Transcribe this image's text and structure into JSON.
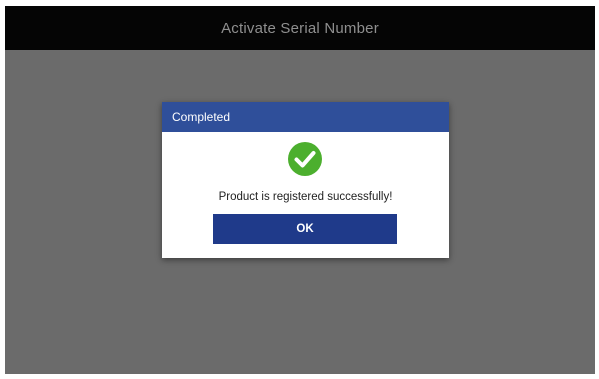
{
  "window": {
    "title": "Activate Serial Number"
  },
  "dialog": {
    "title": "Completed",
    "icon": "checkmark-circle-icon",
    "message": "Product is registered successfully!",
    "ok_label": "OK"
  },
  "colors": {
    "titlebar_bg": "#050505",
    "overlay_bg": "#6b6b6b",
    "dialog_header_bg": "#2f4f9a",
    "button_bg": "#1f3a8a",
    "success_green": "#4caf2e"
  }
}
